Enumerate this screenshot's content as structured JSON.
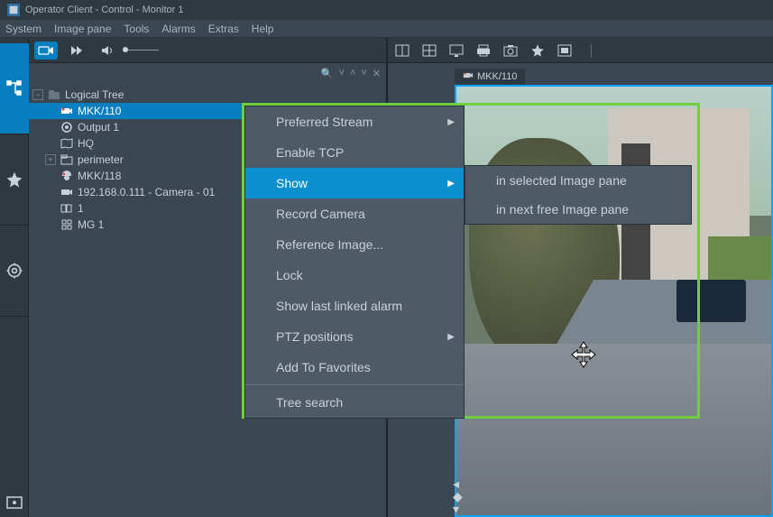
{
  "titlebar": {
    "text": "Operator Client - Control - Monitor 1"
  },
  "menubar": {
    "items": [
      "System",
      "Image pane",
      "Tools",
      "Alarms",
      "Extras",
      "Help"
    ]
  },
  "left_toolbar": {
    "search_glyph": "🔍",
    "chev_up": "˄",
    "chev_down": "˅",
    "close": "✕"
  },
  "tree": {
    "root": "Logical Tree",
    "items": [
      {
        "name": "MKK/110",
        "selected": true,
        "icon": "camera"
      },
      {
        "name": "Output 1",
        "icon": "output"
      },
      {
        "name": "HQ",
        "icon": "map"
      },
      {
        "name": "perimeter",
        "icon": "folder",
        "expandable": true
      },
      {
        "name": "MKK/118",
        "icon": "camera-dome"
      },
      {
        "name": "192.168.0.111 - Camera - 01",
        "icon": "camera"
      },
      {
        "name": "1",
        "icon": "sequence"
      },
      {
        "name": "MG 1",
        "icon": "grid"
      }
    ]
  },
  "context_menu": {
    "items": [
      {
        "label": "Preferred Stream",
        "sub": true
      },
      {
        "label": "Enable TCP"
      },
      {
        "label": "Show",
        "sub": true,
        "highlight": true
      },
      {
        "label": "Record Camera"
      },
      {
        "label": "Reference Image..."
      },
      {
        "label": "Lock"
      },
      {
        "label": "Show last linked alarm"
      },
      {
        "label": "PTZ positions",
        "sub": true
      },
      {
        "label": "Add To Favorites"
      },
      {
        "sep": true
      },
      {
        "label": "Tree search"
      }
    ]
  },
  "submenu": {
    "items": [
      {
        "label": "in selected Image pane"
      },
      {
        "label": "in next free Image pane"
      }
    ]
  },
  "video": {
    "tab_label": "MKK/110"
  }
}
